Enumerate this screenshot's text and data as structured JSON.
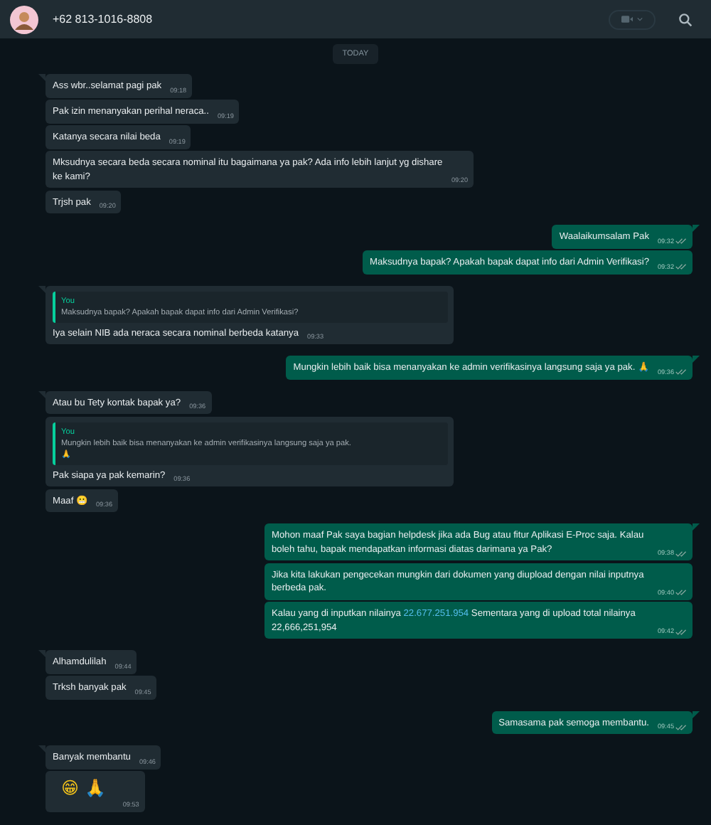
{
  "header": {
    "contact": "+62 813-1016-8808"
  },
  "date_divider": "TODAY",
  "messages": [
    {
      "kind": "in",
      "tail": true,
      "parts": [
        {
          "text": "Ass wbr..selamat pagi pak",
          "kind": "plain"
        }
      ],
      "time": "09:18"
    },
    {
      "kind": "in",
      "tail": false,
      "parts": [
        {
          "text": "Pak izin menanyakan perihal neraca..",
          "kind": "plain"
        }
      ],
      "time": "09:19"
    },
    {
      "kind": "in",
      "tail": false,
      "parts": [
        {
          "text": "Katanya secara nilai beda",
          "kind": "plain"
        }
      ],
      "time": "09:19"
    },
    {
      "kind": "in",
      "tail": false,
      "parts": [
        {
          "text": "Mksudnya secara beda secara nominal itu bagaimana ya pak? Ada info lebih lanjut yg dishare ke kami?",
          "kind": "plain"
        }
      ],
      "time": "09:20"
    },
    {
      "kind": "in",
      "tail": false,
      "parts": [
        {
          "text": "Trjsh pak",
          "kind": "plain"
        }
      ],
      "time": "09:20"
    },
    {
      "kind": "out",
      "tail": true,
      "parts": [
        {
          "text": "Waalaikumsalam Pak",
          "kind": "plain"
        }
      ],
      "time": "09:32"
    },
    {
      "kind": "out",
      "tail": false,
      "parts": [
        {
          "text": "Maksudnya bapak? Apakah bapak dapat info dari Admin Verifikasi?",
          "kind": "plain"
        }
      ],
      "time": "09:32"
    },
    {
      "kind": "in",
      "tail": true,
      "quote": {
        "author": "You",
        "text": "Maksudnya bapak? Apakah bapak dapat info dari Admin Verifikasi?"
      },
      "parts": [
        {
          "text": "Iya selain NIB ada neraca secara nominal berbeda katanya",
          "kind": "plain"
        }
      ],
      "time": "09:33"
    },
    {
      "kind": "out",
      "tail": true,
      "parts": [
        {
          "text": "Mungkin lebih baik bisa menanyakan ke admin verifikasinya langsung saja ya pak. 🙏",
          "kind": "plain"
        }
      ],
      "time": "09:36"
    },
    {
      "kind": "in",
      "tail": true,
      "parts": [
        {
          "text": "Atau bu Tety kontak bapak ya?",
          "kind": "plain"
        }
      ],
      "time": "09:36"
    },
    {
      "kind": "in",
      "tail": false,
      "quote": {
        "author": "You",
        "text": "Mungkin lebih baik bisa menanyakan ke admin verifikasinya langsung saja ya pak.\n🙏"
      },
      "parts": [
        {
          "text": "Pak siapa ya pak kemarin?",
          "kind": "plain"
        }
      ],
      "time": "09:36"
    },
    {
      "kind": "in",
      "tail": false,
      "parts": [
        {
          "text": "Maaf 😬",
          "kind": "plain"
        }
      ],
      "time": "09:36"
    },
    {
      "kind": "out",
      "tail": true,
      "parts": [
        {
          "text": "Mohon maaf Pak saya bagian helpdesk jika ada Bug atau fitur Aplikasi E-Proc saja. Kalau boleh tahu, bapak mendapatkan informasi diatas darimana ya Pak?",
          "kind": "plain"
        }
      ],
      "time": "09:38"
    },
    {
      "kind": "out",
      "tail": false,
      "parts": [
        {
          "text": "Jika kita lakukan pengecekan mungkin dari dokumen yang diupload dengan nilai inputnya berbeda pak.",
          "kind": "plain"
        }
      ],
      "time": "09:40"
    },
    {
      "kind": "out",
      "tail": false,
      "parts": [
        {
          "text": "Kalau yang di inputkan nilainya ",
          "kind": "plain"
        },
        {
          "text": "22.677.251.954",
          "kind": "link"
        },
        {
          "text": " Sementara yang di upload total nilainya 22,666,251,954",
          "kind": "plain"
        }
      ],
      "time": "09:42"
    },
    {
      "kind": "in",
      "tail": true,
      "parts": [
        {
          "text": "Alhamdulilah",
          "kind": "plain"
        }
      ],
      "time": "09:44"
    },
    {
      "kind": "in",
      "tail": false,
      "parts": [
        {
          "text": "Trksh banyak pak",
          "kind": "plain"
        }
      ],
      "time": "09:45"
    },
    {
      "kind": "out",
      "tail": true,
      "parts": [
        {
          "text": "Samasama pak semoga membantu.",
          "kind": "plain"
        }
      ],
      "time": "09:45"
    },
    {
      "kind": "in",
      "tail": true,
      "parts": [
        {
          "text": "Banyak membantu",
          "kind": "plain"
        }
      ],
      "time": "09:46"
    },
    {
      "kind": "in",
      "tail": false,
      "parts": [
        {
          "text": "😁 🙏",
          "kind": "emoji"
        }
      ],
      "time": "09:53"
    }
  ]
}
